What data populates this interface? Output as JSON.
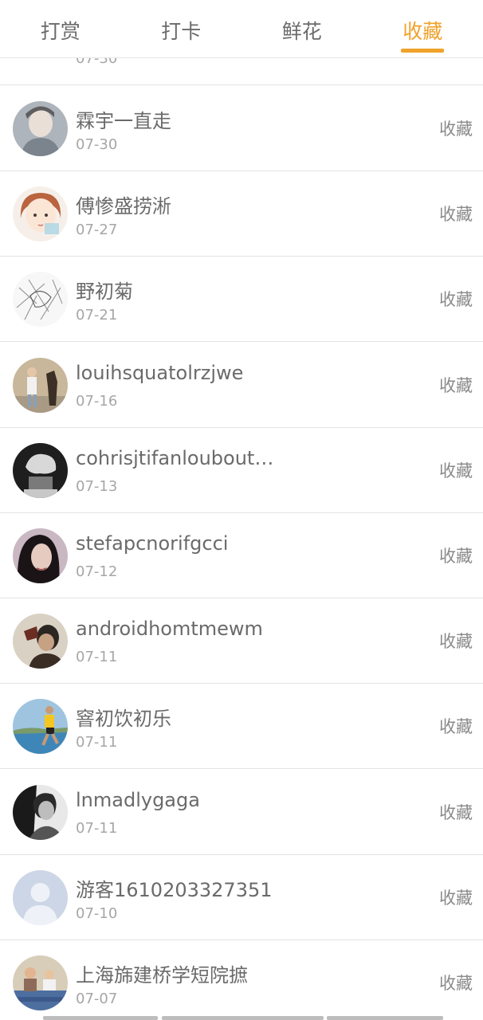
{
  "tabs": [
    {
      "label": "打赏",
      "active": false
    },
    {
      "label": "打卡",
      "active": false
    },
    {
      "label": "鲜花",
      "active": false
    },
    {
      "label": "收藏",
      "active": true
    }
  ],
  "colors": {
    "accent": "#f0a22a",
    "text_primary": "#6a6a6a",
    "text_secondary": "#a6a6a6",
    "divider": "#e3e3e3"
  },
  "partial_row": {
    "date": "07-30"
  },
  "rows": [
    {
      "name": "霖宇一直走",
      "date": "07-30",
      "action": "收藏",
      "avatar_icon": "avatar-person-grey-icon"
    },
    {
      "name": "傅惨盛捞淅",
      "date": "07-27",
      "action": "收藏",
      "avatar_icon": "avatar-cartoon-girl-icon"
    },
    {
      "name": "野初菊",
      "date": "07-21",
      "action": "收藏",
      "avatar_icon": "avatar-sketch-icon"
    },
    {
      "name": "louihsquatolrzjwe",
      "date": "07-16",
      "action": "收藏",
      "avatar_icon": "avatar-person-dog-icon"
    },
    {
      "name": "cohrisjtifanloubout…",
      "date": "07-13",
      "action": "收藏",
      "avatar_icon": "avatar-statue-icon"
    },
    {
      "name": "stefapcnorifgcci",
      "date": "07-12",
      "action": "收藏",
      "avatar_icon": "avatar-woman-dark-icon"
    },
    {
      "name": "androidhomtmewm",
      "date": "07-11",
      "action": "收藏",
      "avatar_icon": "avatar-man-drinking-icon"
    },
    {
      "name": "窨初饮初乐",
      "date": "07-11",
      "action": "收藏",
      "avatar_icon": "avatar-runner-icon"
    },
    {
      "name": "lnmadlygaga",
      "date": "07-11",
      "action": "收藏",
      "avatar_icon": "avatar-man-bw-icon"
    },
    {
      "name": "游客1610203327351",
      "date": "07-10",
      "action": "收藏",
      "avatar_icon": "avatar-default-user-icon"
    },
    {
      "name": "上海旆建桥学短院摭",
      "date": "07-07",
      "action": "收藏",
      "avatar_icon": "avatar-group-photo-icon"
    }
  ]
}
